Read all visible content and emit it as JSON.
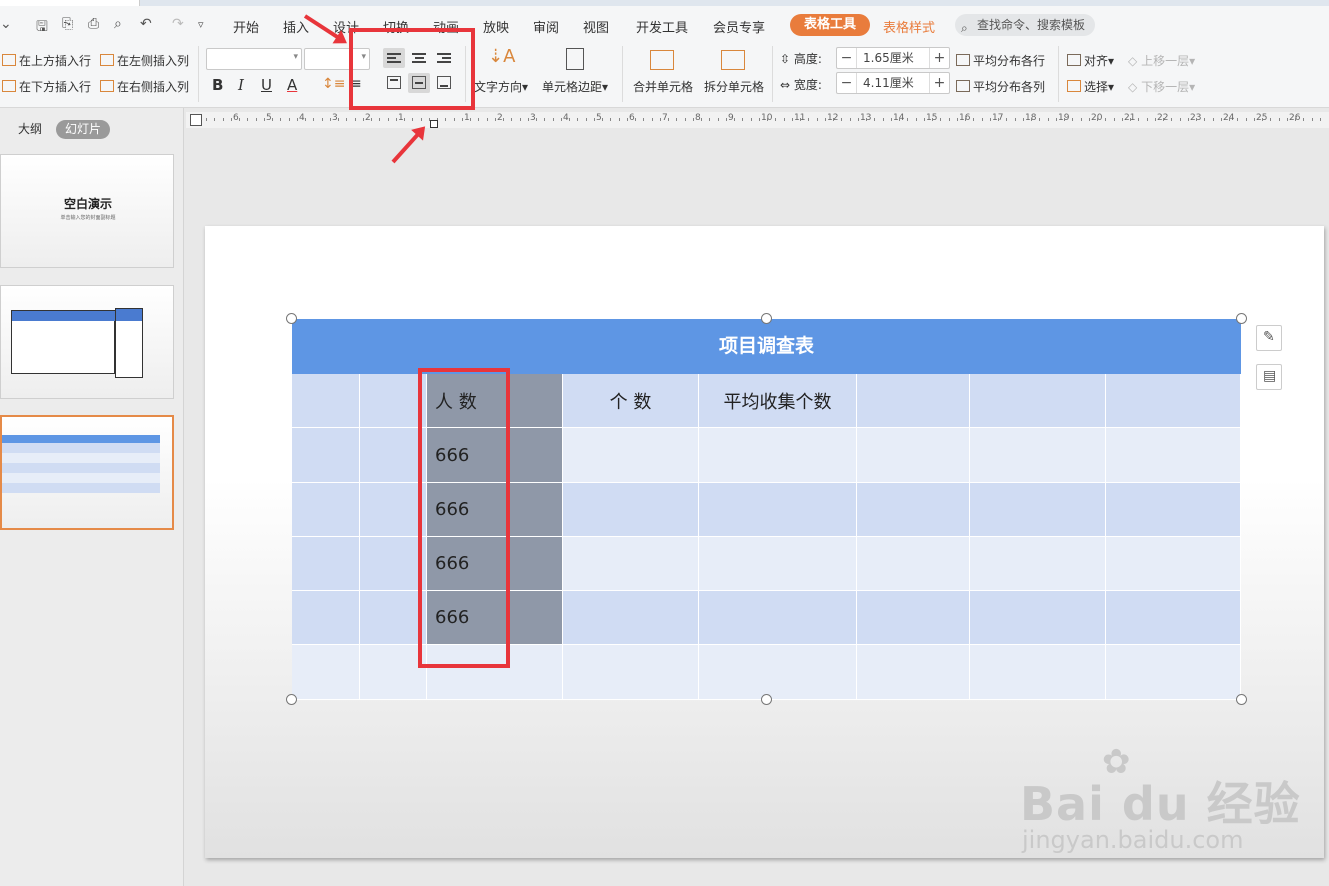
{
  "quick_access": {
    "icons": [
      "menu-caret-icon",
      "save-icon",
      "share-icon",
      "print-icon",
      "preview-icon",
      "undo-icon",
      "redo-icon",
      "more-icon"
    ],
    "menu_label": "≡"
  },
  "menu": {
    "tabs": [
      "开始",
      "插入",
      "设计",
      "切换",
      "动画",
      "放映",
      "审阅",
      "视图",
      "开发工具",
      "会员专享"
    ],
    "active": "表格工具",
    "design": "表格样式",
    "search_placeholder": "查找命令、搜索模板"
  },
  "toolbar": {
    "insert_above": "在上方插入行",
    "insert_left": "在左侧插入列",
    "insert_below": "在下方插入行",
    "insert_right": "在右侧插入列",
    "bold": "B",
    "italic": "I",
    "underline": "U",
    "font_color": "A",
    "text_direction": "文字方向",
    "cell_margin": "单元格边距",
    "merge": "合并单元格",
    "split": "拆分单元格",
    "height_label": "高度:",
    "height_value": "1.65厘米",
    "width_label": "宽度:",
    "width_value": "4.11厘米",
    "dist_rows": "平均分布各行",
    "dist_cols": "平均分布各列",
    "align": "对齐",
    "select": "选择",
    "bring_forward": "上移一层",
    "send_backward": "下移一层",
    "minus": "−",
    "plus": "+"
  },
  "ruler": {
    "left_numbers": [
      "6",
      "5",
      "4",
      "3",
      "2",
      "1"
    ],
    "right_numbers": [
      "1",
      "2",
      "3",
      "4",
      "5",
      "6",
      "7",
      "8",
      "9",
      "10",
      "11",
      "12",
      "13",
      "14",
      "15",
      "16",
      "17",
      "18",
      "19",
      "20",
      "21",
      "22",
      "23",
      "24",
      "25",
      "26"
    ]
  },
  "left_panel": {
    "outline_tab": "大纲",
    "slides_tab": "幻灯片",
    "slide1_title": "空白演示",
    "slide1_subtitle": "单击输入您的封面副标题"
  },
  "table": {
    "title": "项目调查表",
    "header_row": [
      "",
      "",
      "人 数",
      "个 数",
      "平均收集个数",
      "",
      "",
      ""
    ],
    "rows": [
      [
        "",
        "",
        "666",
        "",
        "",
        "",
        "",
        ""
      ],
      [
        "",
        "",
        "666",
        "",
        "",
        "",
        "",
        ""
      ],
      [
        "",
        "",
        "666",
        "",
        "",
        "",
        "",
        ""
      ],
      [
        "",
        "",
        "666",
        "",
        "",
        "",
        "",
        ""
      ],
      [
        "",
        "",
        "",
        "",
        "",
        "",
        "",
        ""
      ]
    ]
  },
  "watermark": {
    "brand": "Bai du 经验",
    "url": "jingyan.baidu.com"
  },
  "colors": {
    "header": "#5e96e4",
    "band_dark": "#d0dcf3",
    "band_light": "#e7edf8",
    "selected_col": "#8f98a8",
    "accent": "#e97c3c",
    "annotation": "#e8353b"
  }
}
